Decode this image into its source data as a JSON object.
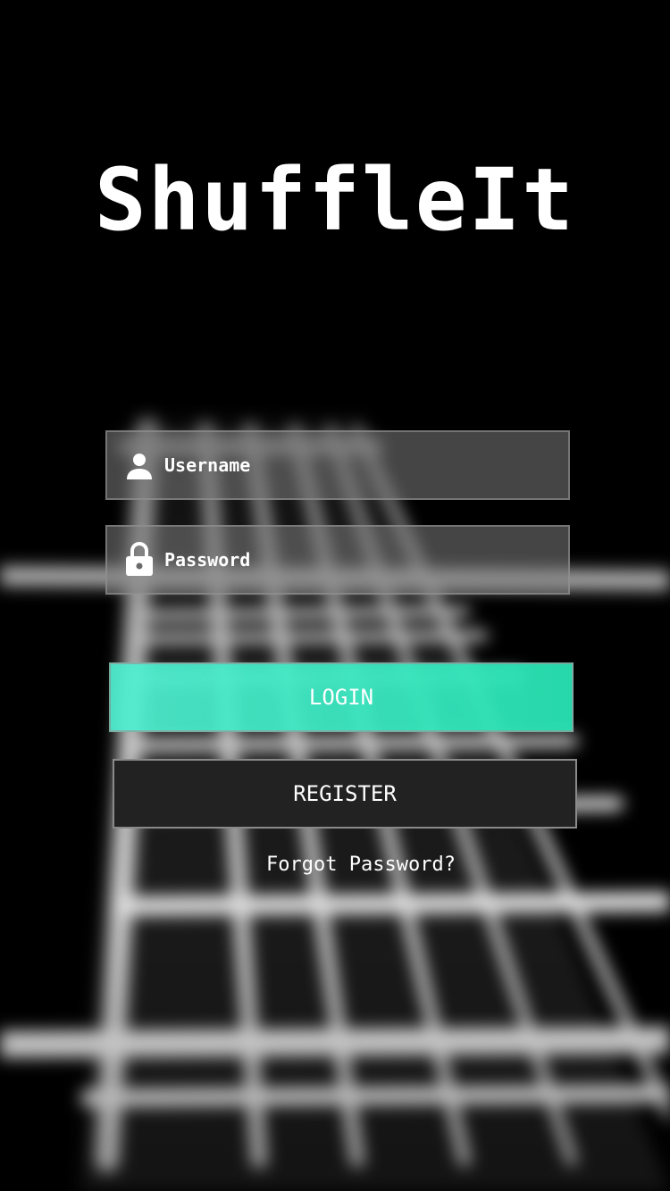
{
  "app": {
    "title": "ShuffleIt"
  },
  "login_form": {
    "username": {
      "placeholder": "Username",
      "value": "",
      "icon": "person-icon"
    },
    "password": {
      "placeholder": "Password",
      "value": "",
      "icon": "lock-icon"
    },
    "login_label": "LOGIN",
    "register_label": "REGISTER",
    "forgot_label": "Forgot Password?"
  },
  "colors": {
    "accent": "#3ee8c4",
    "register_bg": "#222222",
    "field_bg": "#7d7d7d",
    "text": "#ffffff"
  },
  "background": {
    "icon": "guitar-fretboard-image"
  }
}
